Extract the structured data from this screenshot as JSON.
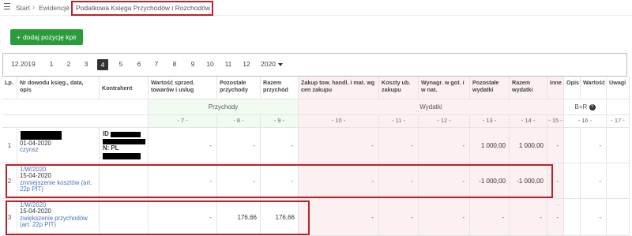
{
  "breadcrumb": {
    "start": "Start",
    "evidence": "Ewidencje",
    "current": "Podatkowa Księga Przychodów i Rozchodów"
  },
  "toolbar": {
    "add_label": "dodaj pozycję kpir",
    "add_icon": "+"
  },
  "pager": {
    "prev_period": "12.2019",
    "months": [
      "1",
      "2",
      "3",
      "4",
      "5",
      "6",
      "7",
      "8",
      "9",
      "10",
      "11",
      "12"
    ],
    "active": "4",
    "year": "2020"
  },
  "table": {
    "headers": {
      "lp": "Lp.",
      "doc": "Nr dowodu księg., data, opis",
      "contractor": "Kontrahent",
      "sales": "Wartość sprzed. towarów i usług",
      "other_income": "Pozostałe przychody",
      "total_income": "Razem przychód",
      "purchase": "Zakup tow. handl. i mat. wg cen zakupu",
      "purchase_costs": "Koszty ub. zakupu",
      "wages": "Wynagr. w got. i w nat.",
      "other_expenses": "Pozostałe wydatki",
      "total_expenses": "Razem wydatki",
      "other": "Inne",
      "desc": "Opis",
      "value": "Wartość",
      "notes": "Uwagi"
    },
    "groups": {
      "income": "Przychody",
      "expenses": "Wydatki",
      "br": "B+R"
    },
    "col_numbers": [
      "- 7 -",
      "- 8 -",
      "- 9 -",
      "- 10 -",
      "- 11 -",
      "- 12 -",
      "- 13 -",
      "- 14 -",
      "- 15 -",
      "- 16 -",
      "- 17 -"
    ],
    "rows": [
      {
        "lp": "1",
        "doc_lines": [
          "01-04-2020",
          "czynsz"
        ],
        "contractor_id": "ID",
        "contractor_nip": "N: PL",
        "sales": "-",
        "other_income": "-",
        "total_income": "-",
        "purchase": "-",
        "purchase_costs": "-",
        "wages": "-",
        "other_expenses": "1 000,00",
        "total_expenses": "1 000,00",
        "other": "-",
        "value": "-"
      },
      {
        "lp": "2",
        "doc_lines": [
          "1/W/2020",
          "15-04-2020",
          "zmniejszenie kosztów (art.",
          "22p PIT)"
        ],
        "sales": "-",
        "other_income": "-",
        "total_income": "-",
        "purchase": "-",
        "purchase_costs": "-",
        "wages": "-",
        "other_expenses": "-1 000,00",
        "total_expenses": "-1 000,00",
        "other": "-",
        "value": "-"
      },
      {
        "lp": "3",
        "doc_lines": [
          "1/W/2020",
          "15-04-2020",
          "zwiększenie przychodów",
          "(art. 22p PIT)"
        ],
        "sales": "-",
        "other_income": "176,66",
        "total_income": "176,66",
        "purchase": "-",
        "purchase_costs": "-",
        "wages": "-",
        "other_expenses": "-",
        "total_expenses": "-",
        "other": "-",
        "value": "-"
      }
    ]
  },
  "colors": {
    "accent_green": "#2a9c3c",
    "highlight_red": "#c0202b",
    "pink": "#fdf0f0",
    "link_blue": "#4a73b8"
  }
}
